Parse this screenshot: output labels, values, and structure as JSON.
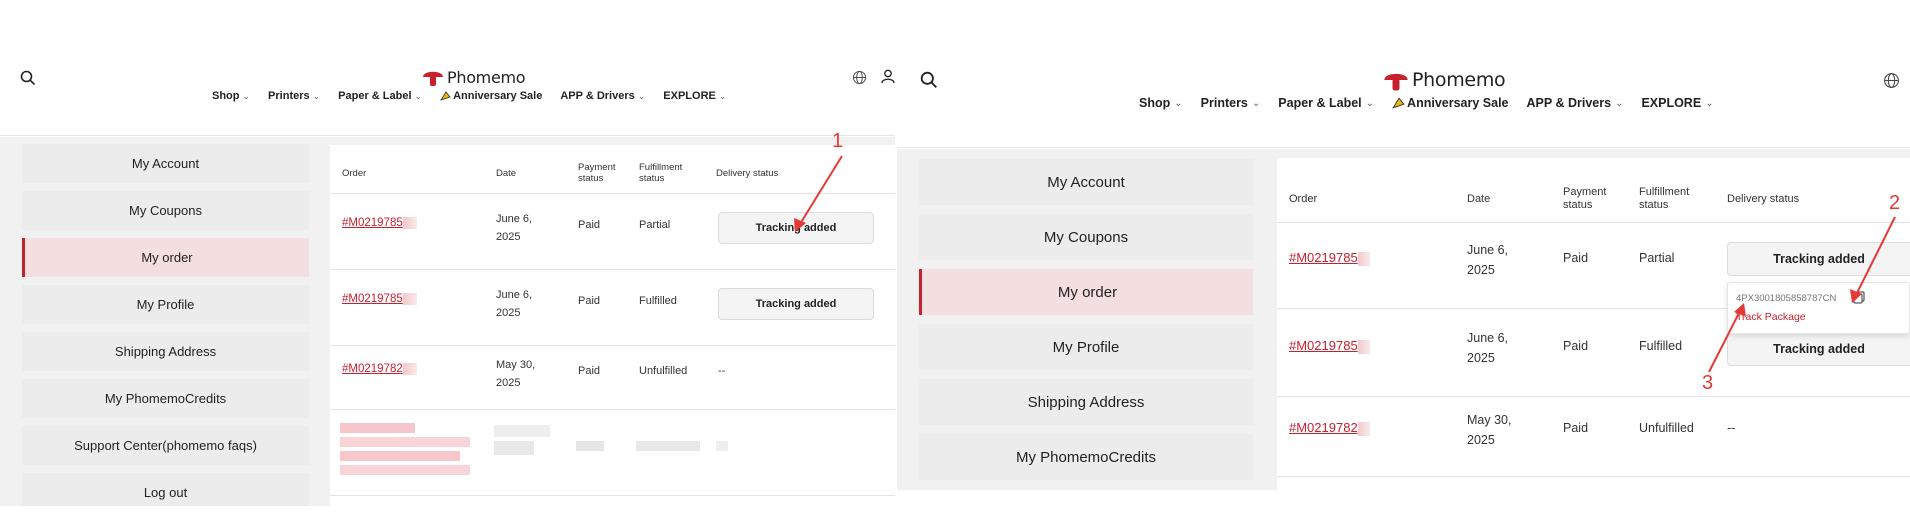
{
  "brand": {
    "name": "Phomemo",
    "color": "#c8202c"
  },
  "nav": {
    "items": [
      {
        "label": "Shop"
      },
      {
        "label": "Printers"
      },
      {
        "label": "Paper & Label"
      },
      {
        "label": "Anniversary Sale"
      },
      {
        "label": "APP & Drivers"
      },
      {
        "label": "EXPLORE"
      }
    ]
  },
  "sidebar": {
    "items": [
      {
        "label": "My Account"
      },
      {
        "label": "My Coupons"
      },
      {
        "label": "My order"
      },
      {
        "label": "My Profile"
      },
      {
        "label": "Shipping Address"
      },
      {
        "label": "My PhomemoCredits"
      },
      {
        "label": "Support Center(phomemo faqs)"
      },
      {
        "label": "Log out"
      }
    ],
    "active_label": "My order"
  },
  "orders_table": {
    "columns": {
      "order": "Order",
      "date": "Date",
      "payment": "Payment status",
      "fulfillment": "Fulfillment status",
      "delivery": "Delivery status"
    },
    "rows": [
      {
        "order": "#M0219785",
        "date": "June 6, 2025",
        "payment": "Paid",
        "fulfillment": "Partial",
        "delivery": "Tracking added"
      },
      {
        "order": "#M0219785",
        "date": "June 6, 2025",
        "payment": "Paid",
        "fulfillment": "Fulfilled",
        "delivery": "Tracking added"
      },
      {
        "order": "#M0219782",
        "date": "May 30, 2025",
        "payment": "Paid",
        "fulfillment": "Unfulfilled",
        "delivery": "--"
      }
    ],
    "right_order_ids": [
      "#M0219785",
      "#M0219785",
      "#M0219782"
    ]
  },
  "tracking_popup": {
    "tracking_number": "4PX3001805858787CN",
    "link_label": "Track Package"
  },
  "annotations": {
    "step1": "1",
    "step2": "2",
    "step3": "3",
    "color": "#e53935"
  },
  "icons": {
    "search": "search-icon",
    "globe": "globe-icon",
    "account": "user-icon",
    "copy": "copy-icon",
    "chevron": "chevron-down-icon",
    "sale": "party-horn-icon"
  }
}
